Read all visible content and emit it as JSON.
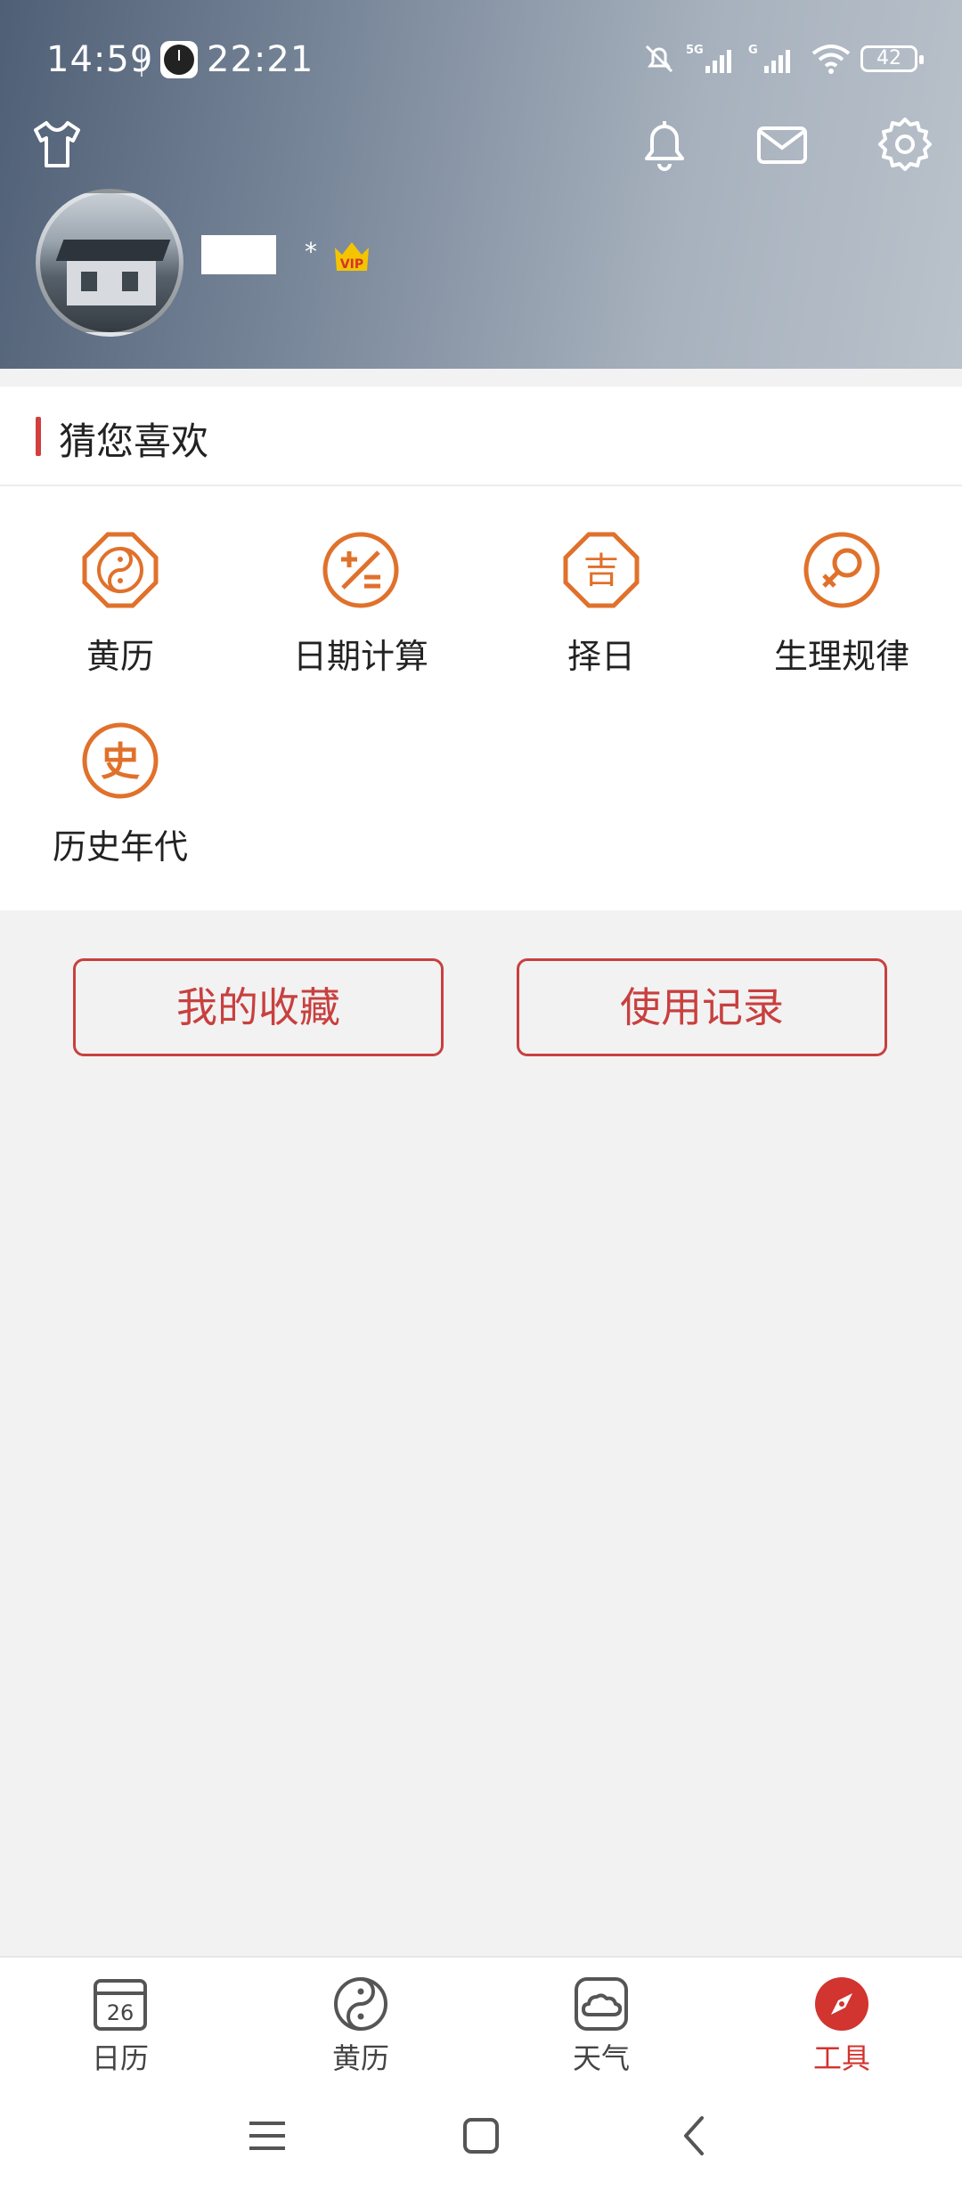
{
  "status_bar": {
    "time": "14:59",
    "clock_time": "22:21",
    "network": "5G",
    "network2": "G",
    "battery": "42"
  },
  "header": {
    "icons": [
      "shirt-icon",
      "bell-icon",
      "mail-icon",
      "gear-icon"
    ],
    "username_suffix": "*",
    "vip_label": "VIP"
  },
  "recommend": {
    "title": "猜您喜欢",
    "items": [
      {
        "label": "黄历",
        "icon": "yin-yang-icon"
      },
      {
        "label": "日期计算",
        "icon": "calculator-icon"
      },
      {
        "label": "择日",
        "icon": "auspicious-icon"
      },
      {
        "label": "生理规律",
        "icon": "female-symbol-icon"
      },
      {
        "label": "历史年代",
        "icon": "history-icon"
      }
    ],
    "history_glyph": "史",
    "auspicious_glyph": "吉"
  },
  "buttons": {
    "favorites": "我的收藏",
    "history": "使用记录"
  },
  "bottom_nav": {
    "items": [
      {
        "label": "日历",
        "icon": "calendar-icon",
        "badge": "26"
      },
      {
        "label": "黄历",
        "icon": "yin-yang-icon"
      },
      {
        "label": "天气",
        "icon": "cloud-icon"
      },
      {
        "label": "工具",
        "icon": "compass-icon",
        "active": true
      }
    ]
  },
  "colors": {
    "accent": "#d2342f",
    "tool_icon": "#e0712b",
    "button_outline": "#c8403f"
  }
}
